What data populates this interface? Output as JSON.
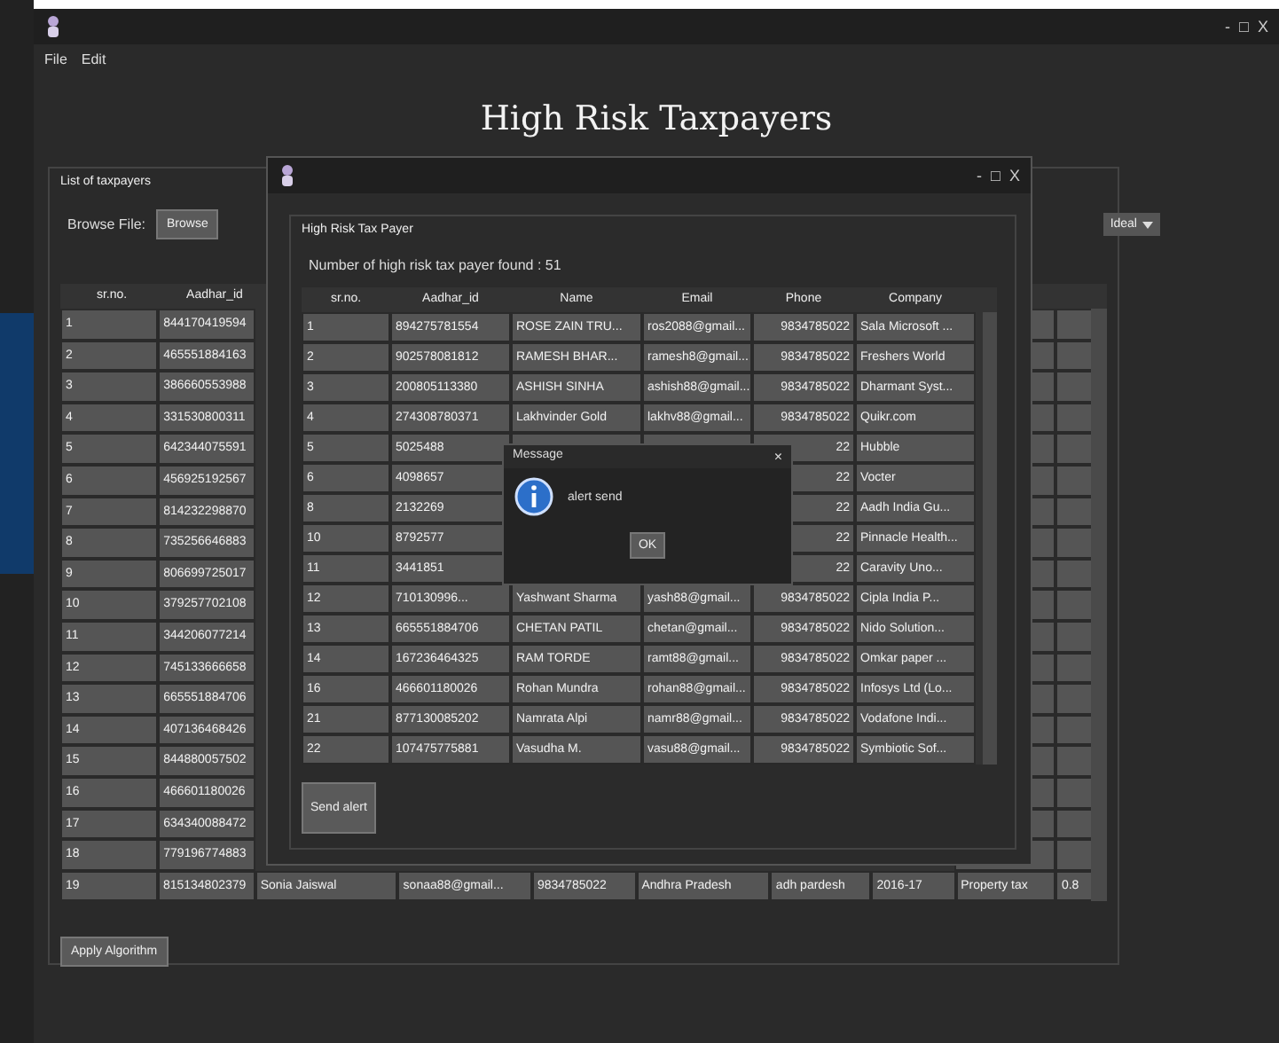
{
  "window": {
    "controls": [
      "-",
      "□",
      "X"
    ]
  },
  "menu": [
    "File",
    "Edit"
  ],
  "heading": "High Risk Taxpayers",
  "panel": {
    "title": "List of taxpayers",
    "browse_label": "Browse File:",
    "browse_button": "Browse",
    "dropdown_value": "Ideal"
  },
  "table": {
    "columns": [
      "sr.no.",
      "Aadhar_id"
    ],
    "rows": [
      [
        "1",
        "844170419594"
      ],
      [
        "2",
        "465551884163"
      ],
      [
        "3",
        "386660553988"
      ],
      [
        "4",
        "331530800311"
      ],
      [
        "5",
        "642344075591"
      ],
      [
        "6",
        "456925192567"
      ],
      [
        "7",
        "814232298870"
      ],
      [
        "8",
        "735256646883"
      ],
      [
        "9",
        "806699725017"
      ],
      [
        "10",
        "379257702108"
      ],
      [
        "11",
        "344206077214"
      ],
      [
        "12",
        "745133666658"
      ],
      [
        "13",
        "665551884706"
      ],
      [
        "14",
        "407136468426"
      ],
      [
        "15",
        "844880057502"
      ],
      [
        "16",
        "466601180026"
      ],
      [
        "17",
        "634340088472"
      ],
      [
        "18",
        "779196774883"
      ],
      [
        "19",
        "815134802379",
        "Sonia Jaiswal",
        "sonaa88@gmail...",
        "9834785022",
        "Andhra Pradesh",
        "adh pardesh",
        "2016-17",
        "Property tax",
        "0.8"
      ]
    ]
  },
  "apply_button": "Apply Algorithm",
  "dialog": {
    "controls": [
      "-",
      "□",
      "X"
    ],
    "group_title": "High Risk Tax Payer",
    "count_text": "Number of high risk tax payer found : 51",
    "columns": [
      "sr.no.",
      "Aadhar_id",
      "Name",
      "Email",
      "Phone",
      "Company"
    ],
    "rows": [
      [
        "1",
        "894275781554",
        "ROSE ZAIN TRU...",
        "ros2088@gmail...",
        "9834785022",
        "Sala Microsoft ..."
      ],
      [
        "2",
        "902578081812",
        "RAMESH BHAR...",
        "ramesh8@gmail...",
        "9834785022",
        "Freshers World"
      ],
      [
        "3",
        "200805113380",
        "ASHISH SINHA",
        "ashish88@gmail...",
        "9834785022",
        "Dharmant Syst..."
      ],
      [
        "4",
        "274308780371",
        "Lakhvinder Gold",
        "lakhv88@gmail...",
        "9834785022",
        "Quikr.com"
      ],
      [
        "5",
        "5025488",
        "",
        "",
        "22",
        "Hubble"
      ],
      [
        "6",
        "4098657",
        "",
        "",
        "22",
        "Vocter"
      ],
      [
        "8",
        "2132269",
        "",
        "",
        "22",
        "Aadh India Gu..."
      ],
      [
        "10",
        "8792577",
        "",
        "",
        "22",
        "Pinnacle Health..."
      ],
      [
        "11",
        "3441851",
        "",
        "",
        "22",
        "Caravity Uno..."
      ],
      [
        "12",
        "710130996...",
        "Yashwant Sharma",
        "yash88@gmail...",
        "9834785022",
        "Cipla India P..."
      ],
      [
        "13",
        "665551884706",
        "CHETAN PATIL",
        "chetan@gmail...",
        "9834785022",
        "Nido Solution..."
      ],
      [
        "14",
        "167236464325",
        "RAM TORDE",
        "ramt88@gmail...",
        "9834785022",
        "Omkar paper ..."
      ],
      [
        "16",
        "466601180026",
        "Rohan Mundra",
        "rohan88@gmail...",
        "9834785022",
        "Infosys Ltd (Lo..."
      ],
      [
        "21",
        "877130085202",
        "Namrata Alpi",
        "namr88@gmail...",
        "9834785022",
        "Vodafone Indi..."
      ],
      [
        "22",
        "107475775881",
        "Vasudha M.",
        "vasu88@gmail...",
        "9834785022",
        "Symbiotic Sof..."
      ]
    ],
    "send_button": "Send alert"
  },
  "message": {
    "title": "Message",
    "close": "×",
    "text": "alert send",
    "ok": "OK"
  }
}
